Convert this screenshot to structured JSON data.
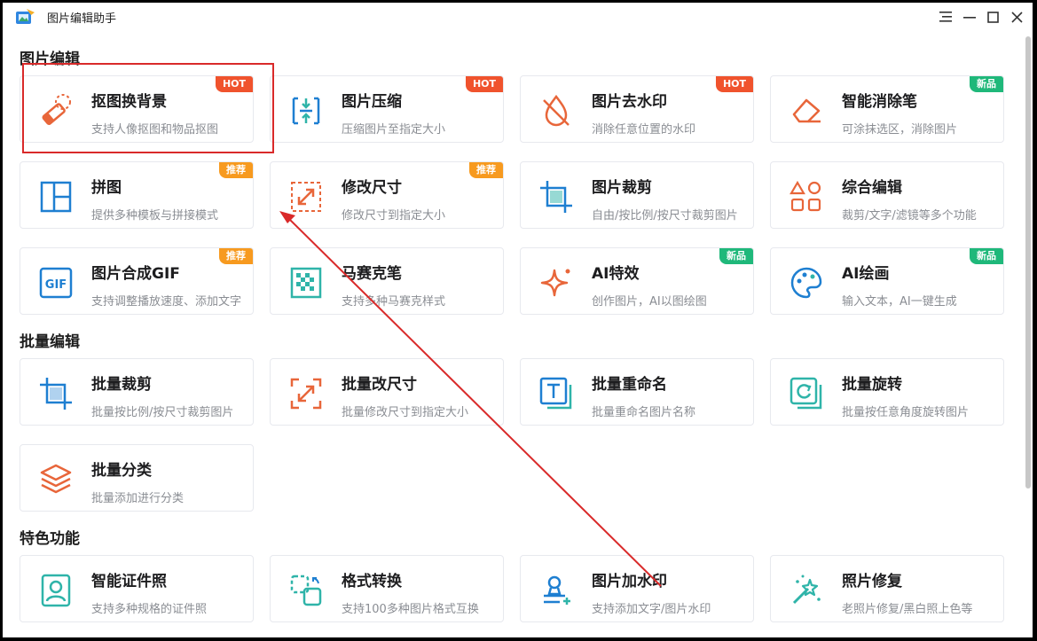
{
  "window": {
    "title": "图片编辑助手",
    "app_icon": "app-logo-icon",
    "controls": [
      "menu-icon",
      "minimize-icon",
      "maximize-icon",
      "close-icon"
    ]
  },
  "colors": {
    "orange": "#e8663a",
    "blue": "#1e7fd1",
    "teal": "#2fb4a9",
    "hot": "#f0532d",
    "recommend": "#f79a1f",
    "new": "#1fb87a"
  },
  "sections": [
    {
      "title": "图片编辑"
    },
    {
      "title": "批量编辑"
    },
    {
      "title": "特色功能"
    }
  ],
  "cards": [
    {
      "title": "抠图换背景",
      "desc": "支持人像抠图和物品抠图",
      "badge": "HOT",
      "icon": "eraser-icon"
    },
    {
      "title": "图片压缩",
      "desc": "压缩图片至指定大小",
      "badge": "HOT",
      "icon": "compress-icon"
    },
    {
      "title": "图片去水印",
      "desc": "消除任意位置的水印",
      "badge": "HOT",
      "icon": "no-drop-icon"
    },
    {
      "title": "智能消除笔",
      "desc": "可涂抹选区，消除图片",
      "badge": "新品",
      "icon": "eraser-pen-icon"
    },
    {
      "title": "拼图",
      "desc": "提供多种模板与拼接模式",
      "badge": "推荐",
      "icon": "collage-icon"
    },
    {
      "title": "修改尺寸",
      "desc": "修改尺寸到指定大小",
      "badge": "推荐",
      "icon": "resize-icon"
    },
    {
      "title": "图片裁剪",
      "desc": "自由/按比例/按尺寸裁剪图片",
      "badge": "",
      "icon": "crop-icon"
    },
    {
      "title": "综合编辑",
      "desc": "裁剪/文字/滤镜等多个功能",
      "badge": "",
      "icon": "shapes-icon"
    },
    {
      "title": "图片合成GIF",
      "desc": "支持调整播放速度、添加文字",
      "badge": "推荐",
      "icon": "gif-icon"
    },
    {
      "title": "马赛克笔",
      "desc": "支持多种马赛克样式",
      "badge": "",
      "icon": "mosaic-icon"
    },
    {
      "title": "AI特效",
      "desc": "创作图片，AI以图绘图",
      "badge": "新品",
      "icon": "sparkle-icon"
    },
    {
      "title": "AI绘画",
      "desc": "输入文本，AI一键生成",
      "badge": "新品",
      "icon": "palette-icon"
    },
    {
      "title": "批量裁剪",
      "desc": "批量按比例/按尺寸裁剪图片",
      "badge": "",
      "icon": "batch-crop-icon"
    },
    {
      "title": "批量改尺寸",
      "desc": "批量修改尺寸到指定大小",
      "badge": "",
      "icon": "batch-resize-icon"
    },
    {
      "title": "批量重命名",
      "desc": "批量重命名图片名称",
      "badge": "",
      "icon": "rename-icon"
    },
    {
      "title": "批量旋转",
      "desc": "批量按任意角度旋转图片",
      "badge": "",
      "icon": "rotate-icon"
    },
    {
      "title": "批量分类",
      "desc": "批量添加进行分类",
      "badge": "",
      "icon": "layers-icon"
    },
    {
      "title": "智能证件照",
      "desc": "支持多种规格的证件照",
      "badge": "",
      "icon": "id-photo-icon"
    },
    {
      "title": "格式转换",
      "desc": "支持100多种图片格式互换",
      "badge": "",
      "icon": "convert-icon"
    },
    {
      "title": "图片加水印",
      "desc": "支持添加文字/图片水印",
      "badge": "",
      "icon": "watermark-icon"
    },
    {
      "title": "照片修复",
      "desc": "老照片修复/黑白照上色等",
      "badge": "",
      "icon": "magic-wand-icon"
    }
  ]
}
